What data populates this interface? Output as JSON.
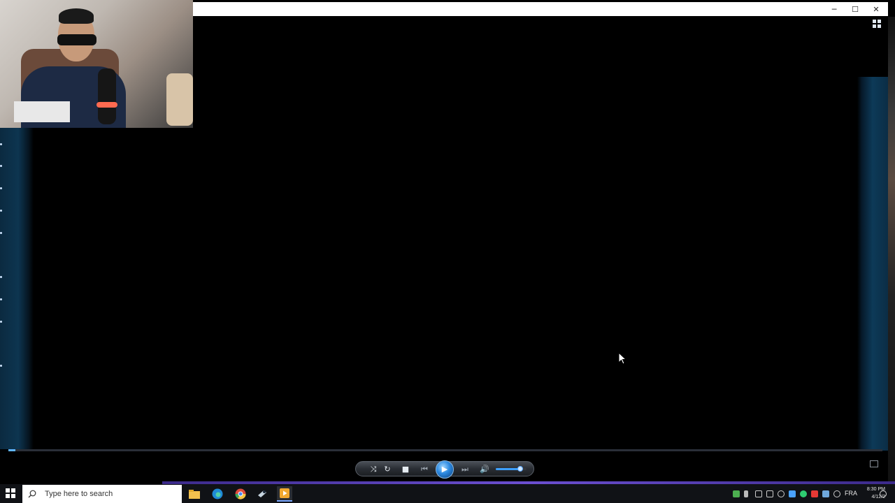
{
  "window": {
    "minimize_icon": "minimize-icon",
    "maximize_icon": "maximize-icon",
    "close_icon": "close-icon",
    "minimize_glyph": "─",
    "maximize_glyph": "☐",
    "close_glyph": "✕"
  },
  "player": {
    "view_toggle_icon": "grid-view-icon",
    "seek_progress": 0.008,
    "volume_level": 0.8,
    "controls": {
      "shuffle_glyph": "⤨",
      "repeat_glyph": "↻",
      "stop_glyph": "■",
      "previous_glyph": "⏮",
      "play_glyph": "▶",
      "next_glyph": "⏭",
      "mute_glyph": "🔊"
    },
    "mini_mode_icon": "switch-to-compact-icon"
  },
  "webcam": {
    "description_icon": "webcam-overlay"
  },
  "taskbar": {
    "search_placeholder": "Type here to search",
    "apps": [
      {
        "name": "file-explorer",
        "color": "#f2c14e"
      },
      {
        "name": "edge",
        "color": "#2fa7e0"
      },
      {
        "name": "chrome",
        "color": "#e04b3c"
      },
      {
        "name": "steam",
        "color": "#c7d5e0"
      },
      {
        "name": "media-player",
        "color": "#f0a830"
      }
    ],
    "tray": {
      "language": "FRA",
      "time": "8:30 PM",
      "date": "4/12/2"
    }
  },
  "colors": {
    "accent_blue": "#2b88e0",
    "taskbar_accent": "#6b4fd1",
    "seek_fill": "#5fb4ff"
  }
}
